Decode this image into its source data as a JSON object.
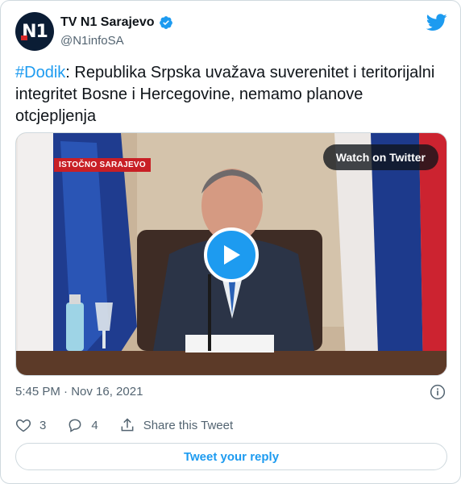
{
  "account": {
    "display_name": "TV N1 Sarajevo",
    "handle": "@N1infoSA",
    "avatar_text": "N1",
    "verified_icon": "verified-badge-icon"
  },
  "tweet": {
    "hashtag": "#Dodik",
    "text": ": Republika Srpska uvažava suverenitet i teritorijalni integritet Bosne i Hercegovine, nemamo planove otcjepljenja"
  },
  "media": {
    "location_tag": "ISTOČNO SARAJEVO",
    "watch_label": "Watch on Twitter"
  },
  "meta": {
    "timestamp": "5:45 PM · Nov 16, 2021"
  },
  "actions": {
    "likes": "3",
    "replies": "4",
    "share_label": "Share this Tweet"
  },
  "reply_button_label": "Tweet your reply",
  "colors": {
    "accent": "#1d9bf0",
    "text_primary": "#0f1419",
    "text_secondary": "#536471",
    "border": "#cfd9de"
  }
}
